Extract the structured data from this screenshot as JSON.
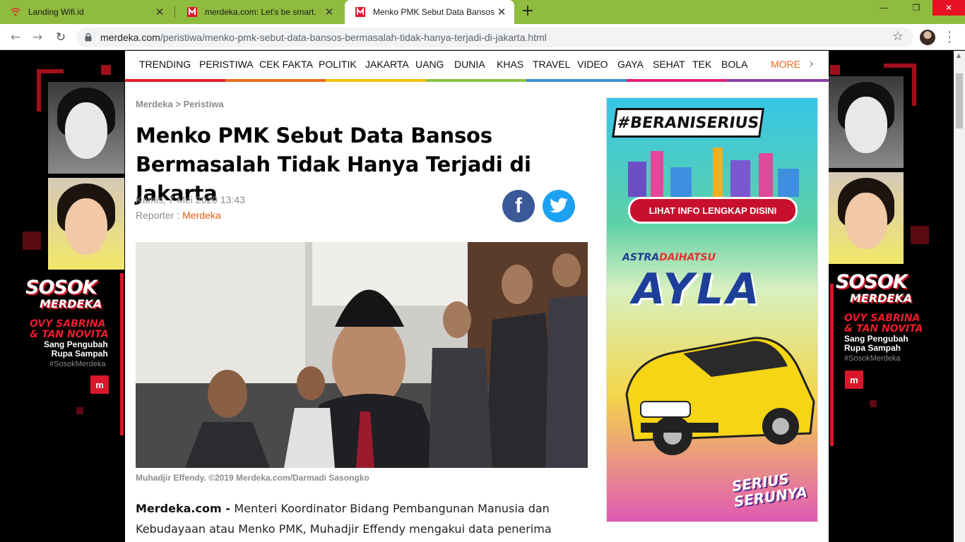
{
  "browser": {
    "tabs": [
      {
        "title": "Landing Wifi.id",
        "icon": "wifi-icon"
      },
      {
        "title": "merdeka.com: Let's be smart.",
        "icon": "merdeka-logo-icon"
      },
      {
        "title": "Menko PMK Sebut Data Bansos B",
        "icon": "merdeka-logo-icon",
        "active": true
      }
    ],
    "new_tab": "+",
    "url_domain": "merdeka.com",
    "url_path": "/peristiwa/menko-pmk-sebut-data-bansos-bermasalah-tidak-hanya-terjadi-di-jakarta.html",
    "window_controls": {
      "minimize": "—",
      "restore": "❐",
      "close": "✕"
    }
  },
  "nav": {
    "items": [
      "TRENDING",
      "PERISTIWA",
      "CEK FAKTA",
      "POLITIK",
      "JAKARTA",
      "UANG",
      "DUNIA",
      "KHAS",
      "TRAVEL",
      "VIDEO",
      "GAYA",
      "SEHAT",
      "TEK",
      "BOLA"
    ],
    "more": "MORE",
    "colors": [
      "#e0202a",
      "#ec6b1e",
      "#f4c013",
      "#8bc43f",
      "#2fa84f",
      "#3a8fd4",
      "#8b3fa8",
      "#e21f76"
    ]
  },
  "article": {
    "breadcrumb": "Merdeka > Peristiwa",
    "title": "Menko PMK Sebut Data Bansos Bermasalah Tidak Hanya Terjadi di Jakarta",
    "date": "Kamis, 7 Mei 2020 13:43",
    "reporter_label": "Reporter : ",
    "reporter": "Merdeka",
    "photo_caption": "Muhadjir Effendy. ©2019 Merdeka.com/Darmadi Sasongko",
    "lead_source": "Merdeka.com - ",
    "lead_text": "Menteri Koordinator Bidang Pembangunan Manusia dan Kebudayaan atau Menko PMK, Muhadjir Effendy mengakui data penerima menjadi"
  },
  "share": {
    "facebook": "f",
    "twitter": "twitter-icon"
  },
  "skin": {
    "title": "SOSOK",
    "subtitle": "MERDEKA",
    "names_line1": "OVY SABRINA",
    "names_line2": "& TAN NOVITA",
    "tagline_line1": "Sang Pengubah",
    "tagline_line2": "Rupa Sampah",
    "hashtag": "#SosokMerdeka",
    "logo": "m"
  },
  "ad": {
    "hashtag": "#BERANISERIUS",
    "cta": "LIHAT INFO LENGKAP DISINI",
    "brand_astra": "ASTRA",
    "brand_daihatsu": "DAIHATSU",
    "model": "AYLA",
    "slogan_line1": "SERIUS",
    "slogan_line2": "SERUNYA"
  }
}
